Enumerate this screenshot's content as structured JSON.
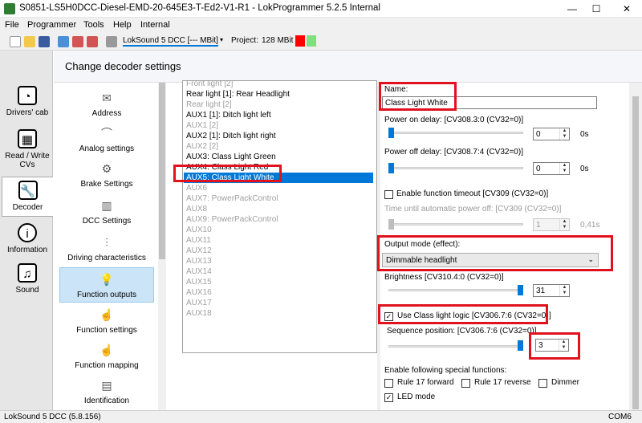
{
  "window": {
    "title": "S0851-LS5H0DCC-Diesel-EMD-20-645E3-T-Ed2-V1-R1 - LokProgrammer 5.2.5 Internal",
    "minimize": "—",
    "maximize": "☐",
    "close": "✕"
  },
  "menu": [
    "File",
    "Programmer",
    "Tools",
    "Help",
    "Internal"
  ],
  "toolbar": {
    "decoder_select": "LokSound 5 DCC [--- MBit]",
    "project_label": "Project:",
    "project_size": "128 MBit"
  },
  "tabs": [
    {
      "label": "Drivers' cab",
      "icon": "gauge-icon"
    },
    {
      "label": "Read / Write CVs",
      "icon": "cv-icon"
    },
    {
      "label": "Decoder",
      "icon": "wrench-icon"
    },
    {
      "label": "Information",
      "icon": "info-icon"
    },
    {
      "label": "Sound",
      "icon": "music-icon"
    }
  ],
  "header": {
    "title": "Change decoder settings"
  },
  "categories": [
    {
      "label": "Address",
      "icon": "envelope-icon"
    },
    {
      "label": "Analog settings",
      "icon": "analog-icon"
    },
    {
      "label": "Brake Settings",
      "icon": "brake-icon"
    },
    {
      "label": "DCC Settings",
      "icon": "dcc-icon"
    },
    {
      "label": "Driving characteristics",
      "icon": "sliders-icon"
    },
    {
      "label": "Function outputs",
      "icon": "lightbulb-icon"
    },
    {
      "label": "Function settings",
      "icon": "function-settings-icon"
    },
    {
      "label": "Function mapping",
      "icon": "function-mapping-icon"
    },
    {
      "label": "Identification",
      "icon": "id-card-icon"
    }
  ],
  "aux_list": [
    "Front light [2]",
    "Rear light [1]: Rear Headlight",
    "Rear light [2]",
    "AUX1 [1]: Ditch light left",
    "AUX1 [2]",
    "AUX2 [1]: Ditch light right",
    "AUX2 [2]",
    "AUX3: Class Light Green",
    "AUX4: Class Light Red",
    "AUX5: Class Light White",
    "AUX6",
    "AUX7: PowerPackControl",
    "AUX8",
    "AUX9: PowerPackControl",
    "AUX10",
    "AUX11",
    "AUX12",
    "AUX13",
    "AUX14",
    "AUX15",
    "AUX16",
    "AUX17",
    "AUX18"
  ],
  "settings": {
    "name_label": "Name:",
    "name_value": "Class Light White",
    "power_on_label": "Power on delay: [CV308.3:0 (CV32=0)]",
    "power_on_value": "0",
    "power_on_unit": "0s",
    "power_off_label": "Power off delay: [CV308.7:4 (CV32=0)]",
    "power_off_value": "0",
    "power_off_unit": "0s",
    "timeout_label": "Enable function timeout [CV309 (CV32=0)]",
    "auto_off_label": "Time until automatic power off: [CV309 (CV32=0)]",
    "auto_off_value": "1",
    "auto_off_unit": "0,41s",
    "output_mode_label": "Output mode (effect):",
    "output_mode_value": "Dimmable headlight",
    "brightness_label": "Brightness [CV310.4:0 (CV32=0)]",
    "brightness_value": "31",
    "class_light_label": "Use Class light logic [CV306.7:6 (CV32=0)]",
    "sequence_label": "Sequence position: [CV306.7:6 (CV32=0)]",
    "sequence_value": "3",
    "special_label": "Enable following special functions:",
    "rule17f_label": "Rule 17 forward",
    "rule17r_label": "Rule 17 reverse",
    "dimmer_label": "Dimmer",
    "led_label": "LED mode"
  },
  "levels": {
    "power_on_fraction": 0.0,
    "power_off_fraction": 0.0,
    "auto_off_fraction": 0.0,
    "brightness_fraction": 1.0,
    "sequence_fraction": 1.0
  },
  "checks": {
    "timeout": false,
    "class_light": true,
    "rule17f": false,
    "rule17r": false,
    "dimmer": false,
    "led": true
  },
  "statusbar": {
    "left": "LokSound 5 DCC (5.8.156)",
    "right": "COM6"
  },
  "colors": {
    "accent": "#0078d7",
    "highlight": "#e0121e",
    "project_red": "#ff0000",
    "project_green": "#7fe07f"
  }
}
